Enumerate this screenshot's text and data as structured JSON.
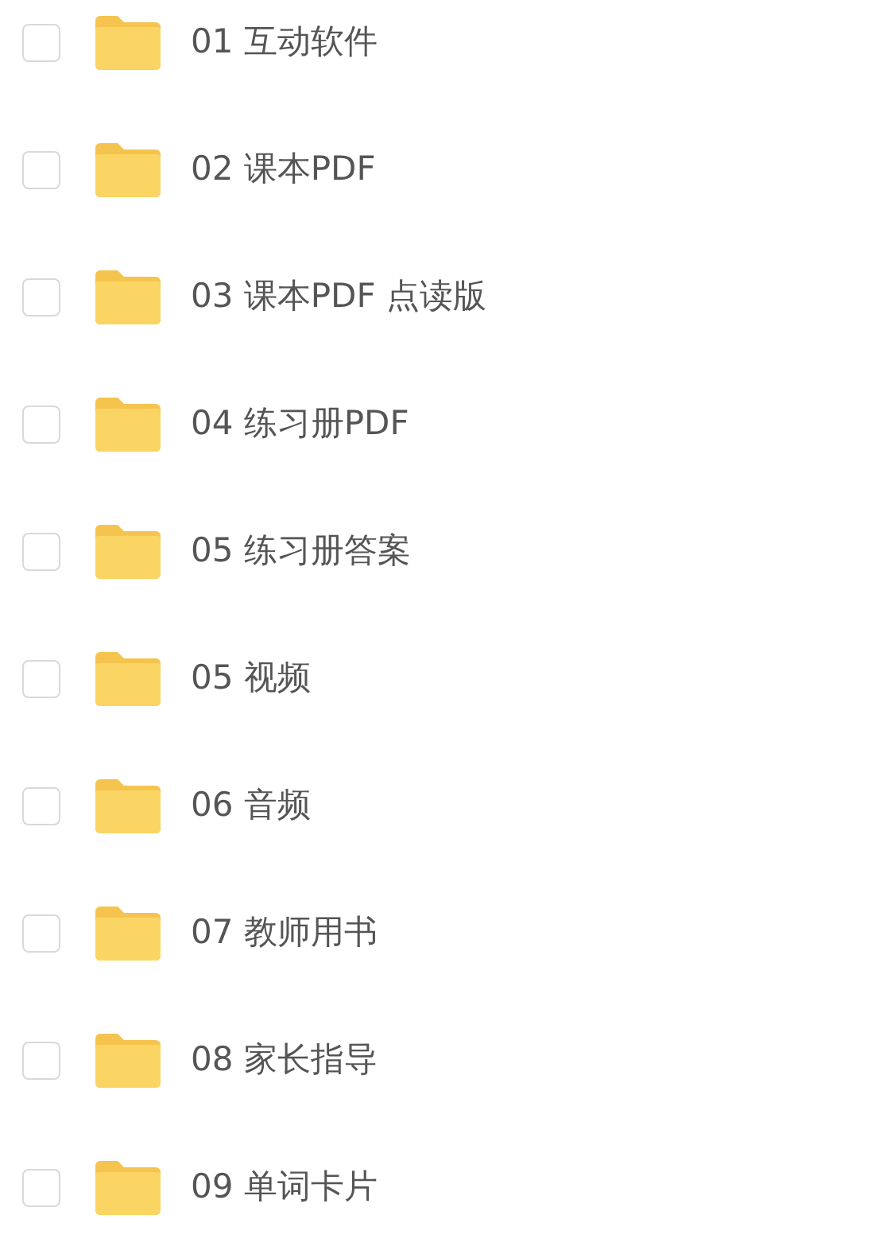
{
  "files": [
    {
      "name": "01 互动软件",
      "checked": false
    },
    {
      "name": "02 课本PDF",
      "checked": false
    },
    {
      "name": "03 课本PDF 点读版",
      "checked": false
    },
    {
      "name": "04 练习册PDF",
      "checked": false
    },
    {
      "name": "05 练习册答案",
      "checked": false
    },
    {
      "name": "05 视频",
      "checked": false
    },
    {
      "name": "06 音频",
      "checked": false
    },
    {
      "name": "07 教师用书",
      "checked": false
    },
    {
      "name": "08 家长指导",
      "checked": false
    },
    {
      "name": "09 单词卡片",
      "checked": false
    }
  ]
}
